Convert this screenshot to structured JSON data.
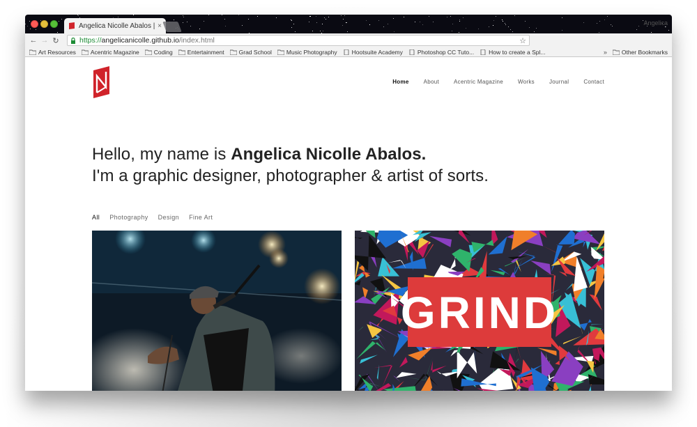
{
  "browser": {
    "tab_title": "Angelica Nicolle Abalos | Graphic",
    "tab_close": "×",
    "profile_label": "Angelica",
    "url_https": "https://",
    "url_domain": "angelicanicolle.github.io",
    "url_path": "/index.html",
    "back_icon": "arrow-left-icon",
    "forward_icon": "arrow-right-icon",
    "reload_icon": "reload-icon",
    "bookmark_star_icon": "star-icon"
  },
  "bookmarks": {
    "items": [
      {
        "label": "Art Resources",
        "icon": "folder-icon"
      },
      {
        "label": "Acentric Magazine",
        "icon": "folder-icon"
      },
      {
        "label": "Coding",
        "icon": "folder-icon"
      },
      {
        "label": "Entertainment",
        "icon": "folder-icon"
      },
      {
        "label": "Grad School",
        "icon": "folder-icon"
      },
      {
        "label": "Music Photography",
        "icon": "folder-icon"
      },
      {
        "label": "Hootsuite Academy",
        "icon": "page-icon"
      },
      {
        "label": "Photoshop CC Tuto...",
        "icon": "page-icon"
      },
      {
        "label": "How to create a Spl...",
        "icon": "page-icon"
      }
    ],
    "more": "»",
    "other": "Other Bookmarks"
  },
  "nav": {
    "items": [
      "Home",
      "About",
      "Acentric Magazine",
      "Works",
      "Journal",
      "Contact"
    ],
    "active": "Home"
  },
  "hero": {
    "line1_prefix": "Hello, my name is ",
    "line1_name": "Angelica Nicolle Abalos.",
    "line2": "I'm a graphic designer, photographer & artist of sorts."
  },
  "filters": {
    "items": [
      "All",
      "Photography",
      "Design",
      "Fine Art"
    ],
    "active": "All"
  },
  "cards": [
    {
      "kind": "concert-photo"
    },
    {
      "kind": "grind-artwork",
      "text": "GRIND"
    }
  ],
  "colors": {
    "logo_red": "#d0232a",
    "grind_red": "#dd3b3b"
  }
}
